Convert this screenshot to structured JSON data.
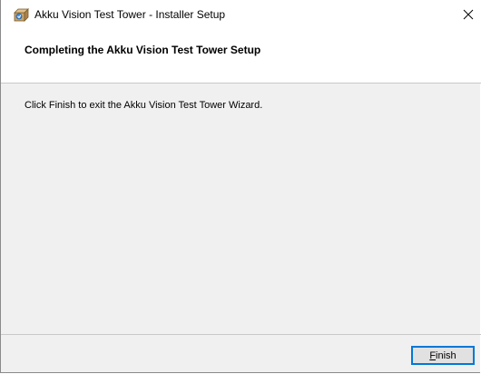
{
  "window": {
    "title": "Akku Vision Test Tower - Installer Setup",
    "icon": "installer-box-icon",
    "close_glyph": "✕"
  },
  "header": {
    "title": "Completing the Akku Vision Test Tower Setup"
  },
  "body": {
    "message": "Click Finish to exit the Akku Vision Test Tower Wizard."
  },
  "footer": {
    "finish_mnemonic": "F",
    "finish_rest": "inish"
  },
  "colors": {
    "accent": "#0078d7",
    "dialog_bg": "#f0f0f0",
    "header_bg": "#ffffff"
  }
}
